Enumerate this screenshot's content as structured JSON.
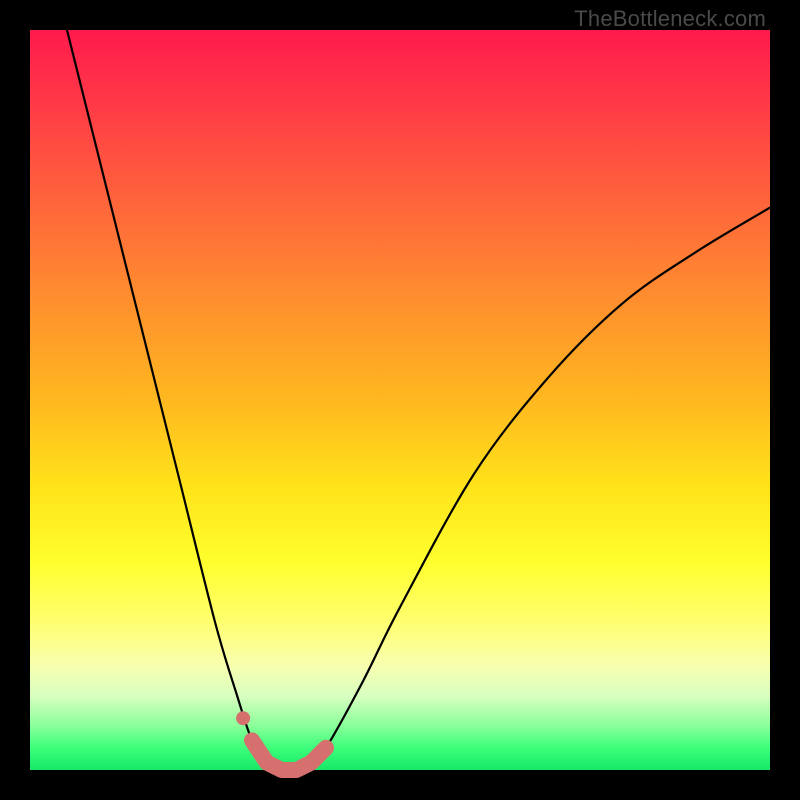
{
  "watermark": "TheBottleneck.com",
  "chart_data": {
    "type": "line",
    "title": "",
    "xlabel": "",
    "ylabel": "",
    "xlim": [
      0,
      100
    ],
    "ylim": [
      0,
      100
    ],
    "series": [
      {
        "name": "bottleneck-curve",
        "x": [
          5,
          10,
          15,
          20,
          25,
          28,
          30,
          32,
          34,
          36,
          38,
          40,
          45,
          50,
          60,
          70,
          80,
          90,
          100
        ],
        "values": [
          100,
          80,
          60,
          40,
          20,
          10,
          4,
          1,
          0,
          0,
          1,
          3,
          12,
          22,
          40,
          53,
          63,
          70,
          76
        ]
      }
    ],
    "highlight": {
      "name": "highlight-dots",
      "x": [
        30,
        32,
        33,
        34,
        35,
        36,
        37,
        38,
        39,
        40
      ],
      "values": [
        4,
        1,
        0.5,
        0,
        0,
        0,
        0.5,
        1,
        2,
        3
      ]
    },
    "gradient_stops": [
      {
        "pos": 0.0,
        "color": "#ff1a4d"
      },
      {
        "pos": 0.5,
        "color": "#ffe41a"
      },
      {
        "pos": 0.9,
        "color": "#d8ffc0"
      },
      {
        "pos": 1.0,
        "color": "#17e867"
      }
    ]
  },
  "colors": {
    "curve_stroke": "#000000",
    "highlight_fill": "#d6706f",
    "frame_bg": "#000000"
  }
}
